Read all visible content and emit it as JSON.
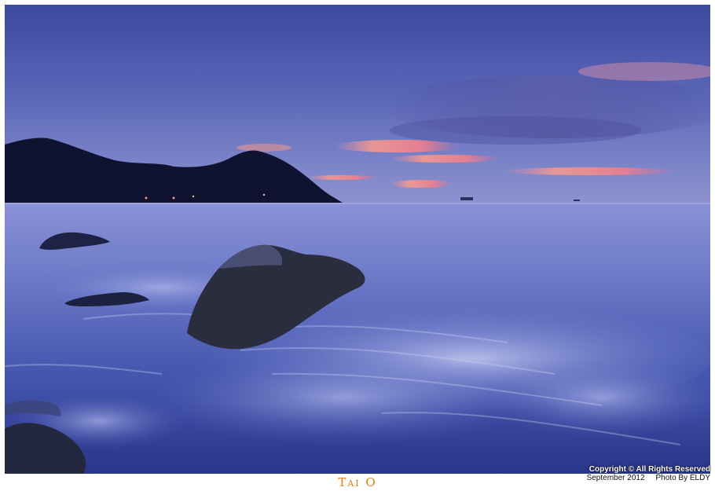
{
  "photo": {
    "subject": "seascape-sunset-photo"
  },
  "caption": {
    "title": "Tai O"
  },
  "credits": {
    "copyright": "Copyright © All Rights Reserved",
    "date": "September 2012",
    "author": "Photo By ELDY"
  }
}
